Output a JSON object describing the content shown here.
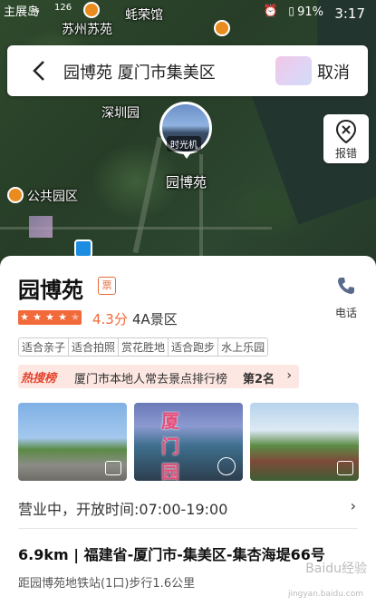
{
  "status_bar": {
    "carrier": "主展岛",
    "signal": "₄₆",
    "wifi": "126",
    "battery": "91%",
    "time": "3:17"
  },
  "map": {
    "labels": [
      "苏州苏苑",
      "蚝荣馆",
      "深圳园",
      "公共园区"
    ],
    "pin_tag": "时光机",
    "pin_name": "园博苑"
  },
  "search": {
    "query": "园博苑 厦门市集美区",
    "cancel_label": "取消"
  },
  "report": {
    "label": "报错"
  },
  "place": {
    "name": "园博苑",
    "ticket_tag": "票",
    "phone_label": "电话",
    "stars_filled": 4,
    "score": "4.3分",
    "level": "4A景区",
    "tags": [
      "适合亲子",
      "适合拍照",
      "赏花胜地",
      "适合跑步",
      "水上乐园"
    ],
    "rank": {
      "badge": "热搜榜",
      "text": "厦门市本地人常去景点排行榜",
      "position": "第2名"
    },
    "photos": [
      {
        "name": "photo-entrance",
        "overlay": ""
      },
      {
        "name": "photo-aerial",
        "overlay": "厦 门 园 博"
      },
      {
        "name": "photo-pavilion",
        "overlay": ""
      }
    ],
    "hours": "营业中，开放时间:07:00-19:00",
    "address": "6.9km | 福建省-厦门市-集美区-集杏海堤66号",
    "metro": "距园博苑地铁站(1口)步行1.6公里"
  },
  "watermark": {
    "main": "Baidu经验",
    "sub": "jingyan.baidu.com"
  },
  "colors": {
    "accent": "#f26a3a",
    "hot": "#e5432e",
    "rank_bg": "#fde7e2"
  }
}
